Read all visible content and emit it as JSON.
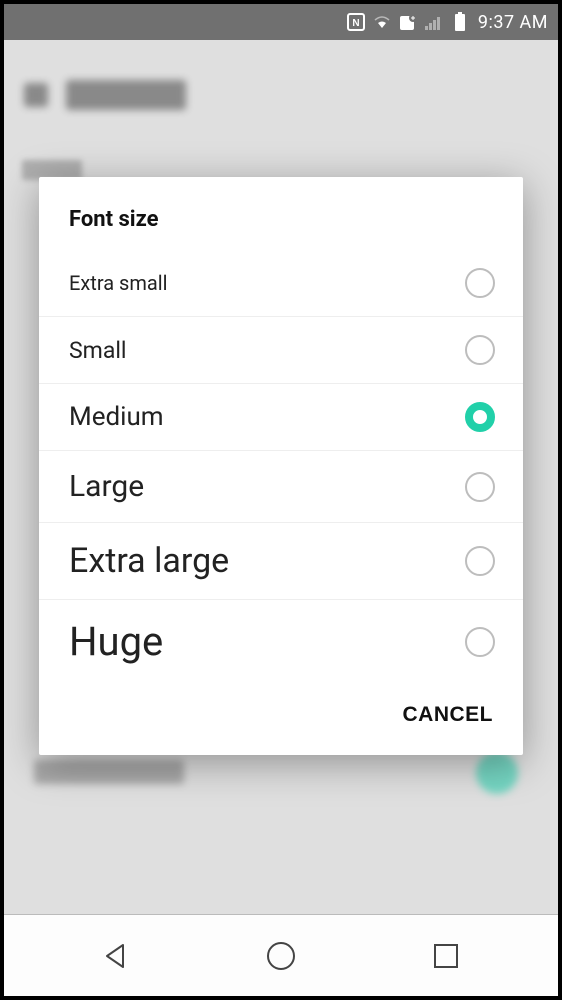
{
  "status_bar": {
    "time": "9:37 AM",
    "icons": [
      "nfc-icon",
      "wifi-icon",
      "data-icon",
      "signal-icon",
      "battery-icon"
    ]
  },
  "dialog": {
    "title": "Font size",
    "options": [
      {
        "label": "Extra small",
        "font_size_px": 20,
        "selected": false
      },
      {
        "label": "Small",
        "font_size_px": 23,
        "selected": false
      },
      {
        "label": "Medium",
        "font_size_px": 26,
        "selected": true
      },
      {
        "label": "Large",
        "font_size_px": 30,
        "selected": false
      },
      {
        "label": "Extra large",
        "font_size_px": 34,
        "selected": false
      },
      {
        "label": "Huge",
        "font_size_px": 40,
        "selected": false
      }
    ],
    "cancel_label": "CANCEL"
  },
  "nav": {
    "back": "back-icon",
    "home": "home-icon",
    "recent": "recent-icon"
  },
  "colors": {
    "accent": "#21d0a9",
    "radio_inactive": "#bdbdbd"
  }
}
